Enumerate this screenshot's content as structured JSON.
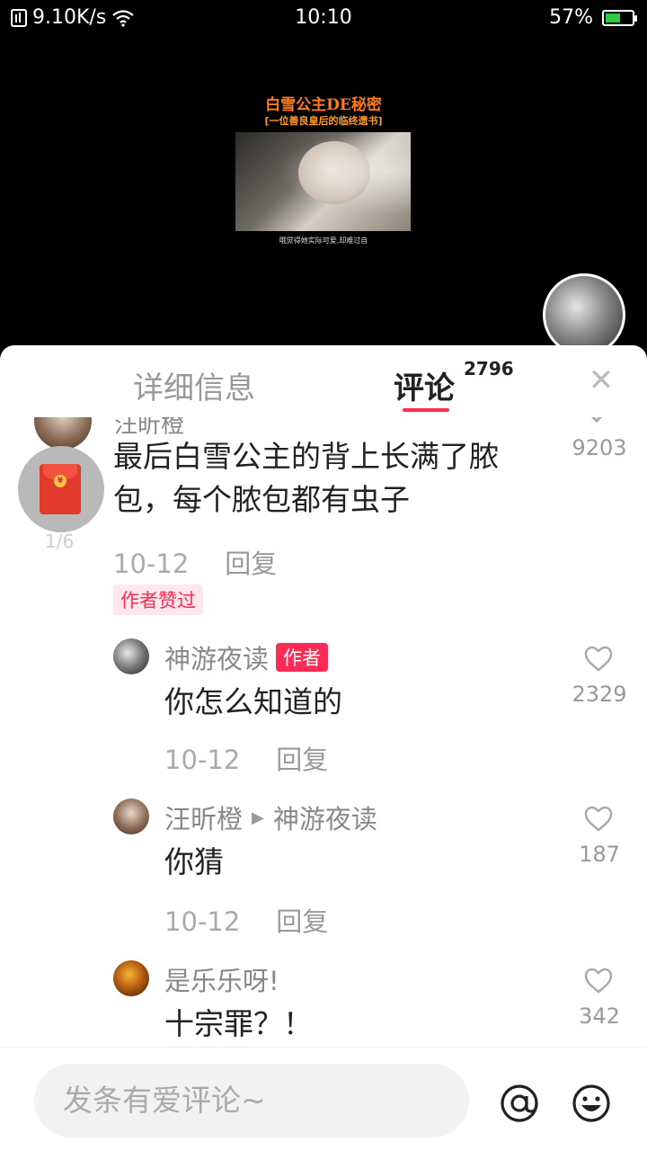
{
  "status_bar": {
    "network_speed": "9.10K/s",
    "time": "10:10",
    "battery_percent": "57%",
    "battery_level": 0.57,
    "battery_color": "#2ecc40"
  },
  "video": {
    "title": "白雪公主DE秘密",
    "subtitle": "[一位善良皇后的临终遗书]",
    "caption": "哦觉得她实际可爱,却难过自"
  },
  "tabs": {
    "details_label": "详细信息",
    "comments_label": "评论",
    "comments_count": "2796"
  },
  "main_comment": {
    "author_partial": "汪昕橙",
    "text": "最后白雪公主的背上长满了脓包，每个脓包都有虫子",
    "like_count": "9203",
    "date": "10-12",
    "reply_label": "回复",
    "author_liked_badge": "作者赞过",
    "redpacket_counter": "1/6"
  },
  "replies": [
    {
      "author": "神游夜读",
      "author_tag": "作者",
      "text": "你怎么知道的",
      "like_count": "2329",
      "date": "10-12",
      "reply_label": "回复"
    },
    {
      "author": "汪昕橙",
      "reply_to": "神游夜读",
      "text": "你猜",
      "like_count": "187",
      "date": "10-12",
      "reply_label": "回复"
    },
    {
      "author": "是乐乐呀!",
      "text": "十宗罪？！",
      "like_count": "342"
    }
  ],
  "bottom_bar": {
    "input_placeholder": "发条有爱评论~"
  },
  "colors": {
    "accent": "#fe2c55",
    "video_title": "#ff7a1a"
  }
}
